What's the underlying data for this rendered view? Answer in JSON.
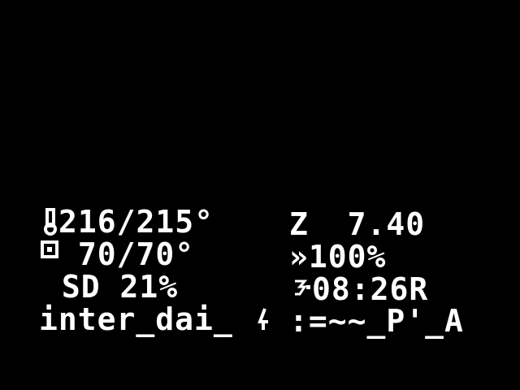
{
  "lcd": {
    "hotend": {
      "icon": "thermometer-icon",
      "temps": "216/215°"
    },
    "bed": {
      "icon": "bed-icon",
      "temps": " 70/70°"
    },
    "sd": {
      "text": " SD 21%"
    },
    "status": {
      "text": "inter_dai_"
    },
    "z": {
      "text": "Z  7.40"
    },
    "feedrate": {
      "icon": "feedrate-icon",
      "value": "»100%"
    },
    "time": {
      "icon": "clock-icon",
      "value": "08:26R"
    },
    "garbage": {
      "text": ":=~~_P'_A"
    }
  },
  "colors": {
    "background": "#000000",
    "foreground": "#ffffff"
  }
}
